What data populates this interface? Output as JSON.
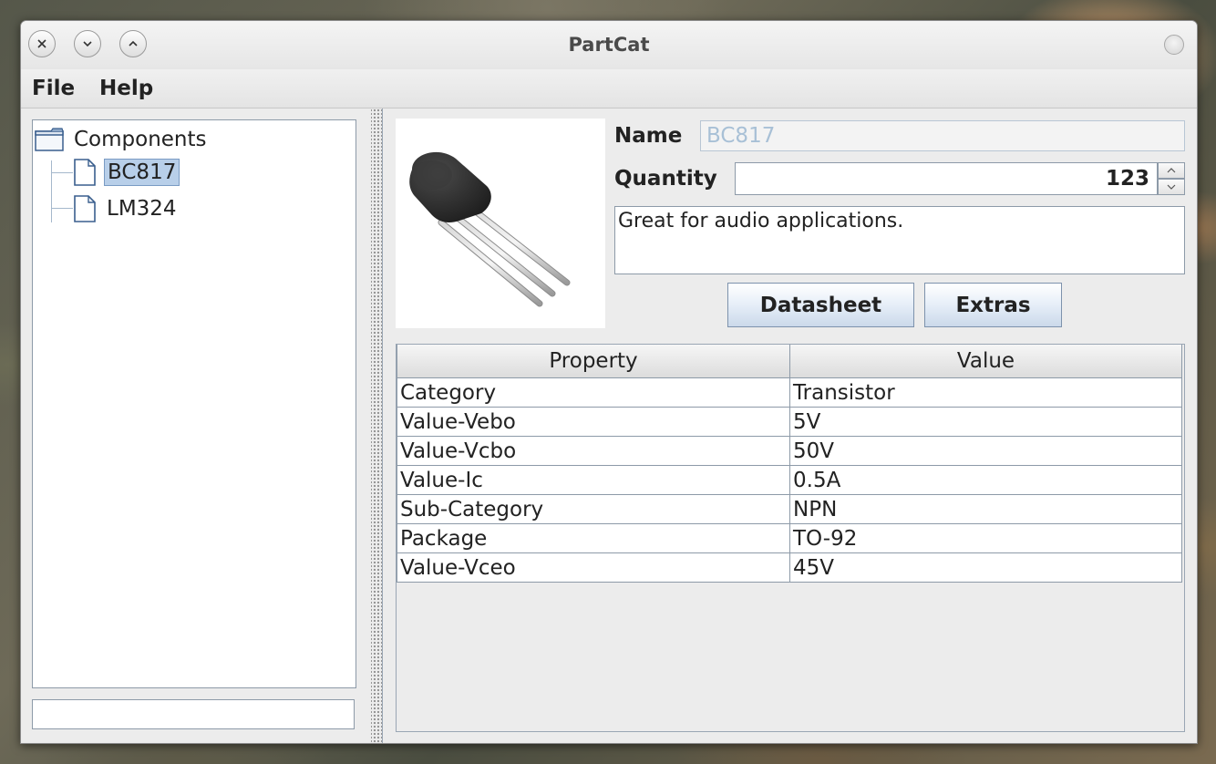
{
  "window": {
    "title": "PartCat"
  },
  "menu": {
    "file": "File",
    "help": "Help"
  },
  "tree": {
    "root": "Components",
    "items": [
      {
        "label": "BC817",
        "selected": true
      },
      {
        "label": "LM324",
        "selected": false
      }
    ]
  },
  "search": {
    "value": ""
  },
  "detail": {
    "image_icon": "transistor-to92-image",
    "name_label": "Name",
    "name_value": "BC817",
    "quantity_label": "Quantity",
    "quantity_value": "123",
    "description": "Great for audio applications.",
    "datasheet_button": "Datasheet",
    "extras_button": "Extras"
  },
  "properties": {
    "headers": [
      "Property",
      "Value"
    ],
    "rows": [
      [
        "Category",
        "Transistor"
      ],
      [
        "Value-Vebo",
        "5V"
      ],
      [
        "Value-Vcbo",
        "50V"
      ],
      [
        "Value-Ic",
        "0.5A"
      ],
      [
        "Sub-Category",
        "NPN"
      ],
      [
        "Package",
        "TO-92"
      ],
      [
        "Value-Vceo",
        "45V"
      ]
    ]
  },
  "colors": {
    "selection": "#b8cfe9",
    "name_text_disabled": "#a8c0d6",
    "border": "#8d9aa8"
  }
}
